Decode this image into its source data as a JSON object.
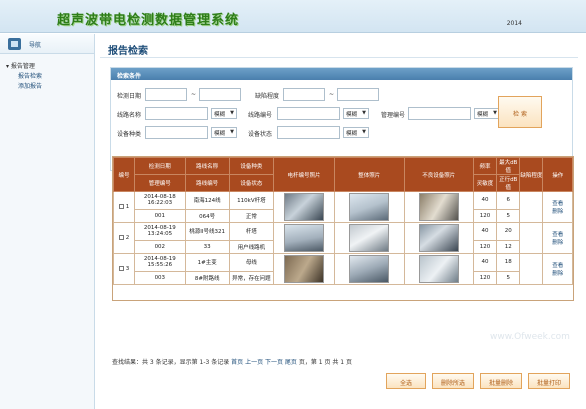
{
  "header": {
    "title": "超声波带电检测数据管理系统",
    "right_text": "2014"
  },
  "sidebar": {
    "nav_title": "导航",
    "group": "报告管理",
    "items": [
      {
        "label": "报告检索"
      },
      {
        "label": "添加报告"
      }
    ]
  },
  "main": {
    "page_title": "报告检索"
  },
  "search": {
    "header": "检索条件",
    "labels": {
      "detect_date": "检测日期",
      "defect_degree": "缺陷程度",
      "line_name": "线路名称",
      "line_no": "线路编号",
      "unit_no": "管理编号",
      "equip_type": "设备种类",
      "equip_status": "设备状态"
    },
    "tilde": "~",
    "fuzzy_option": "模糊",
    "search_button": "检 索"
  },
  "table": {
    "headers_top": [
      "编号",
      "检测日期",
      "路线名称",
      "设备种类",
      "电杆编号照片",
      "整体照片",
      "不良设备照片",
      "频率",
      "最大dB值",
      "缺陷程度",
      "操作"
    ],
    "headers_bottom": [
      "管理编号",
      "路线编号",
      "设备状态",
      "灵敏度",
      "正行dB值"
    ],
    "rows": [
      {
        "no": "1",
        "date": "2014-08-18 16:22:03",
        "line_name": "南海124线",
        "equip_type": "110kV杆塔",
        "mgmt_no": "001",
        "line_no": "064号",
        "status": "正常",
        "freq": "40",
        "max_db": "6",
        "sens": "120",
        "db2": "5",
        "op_view": "查看",
        "op_del": "删除"
      },
      {
        "no": "2",
        "date": "2014-08-19 13:24:05",
        "line_name": "桃源II号线321",
        "equip_type": "杆塔",
        "mgmt_no": "002",
        "line_no": "33",
        "status": "用户线路机",
        "freq": "40",
        "max_db": "20",
        "sens": "120",
        "db2": "12",
        "op_view": "查看",
        "op_del": "删除"
      },
      {
        "no": "3",
        "date": "2014-08-19 15:55:26",
        "line_name": "1#主变",
        "equip_type": "母线",
        "mgmt_no": "003",
        "line_no": "8#附路线",
        "status": "异常，存在问题",
        "freq": "40",
        "max_db": "18",
        "sens": "120",
        "db2": "5",
        "op_view": "查看",
        "op_del": "删除"
      }
    ]
  },
  "pagination": {
    "summary": "查找结果：共 3 条记录，显示第 1-3 条记录",
    "links": "首页 上一页 下一页 尾页",
    "page_info": "页，第 1 页 共 1 页"
  },
  "actions": {
    "select_all": "全选",
    "delete_selected": "删除所选",
    "batch_delete": "批量删除",
    "batch_print": "批量打印"
  },
  "watermark": "www.Ofweek.com"
}
